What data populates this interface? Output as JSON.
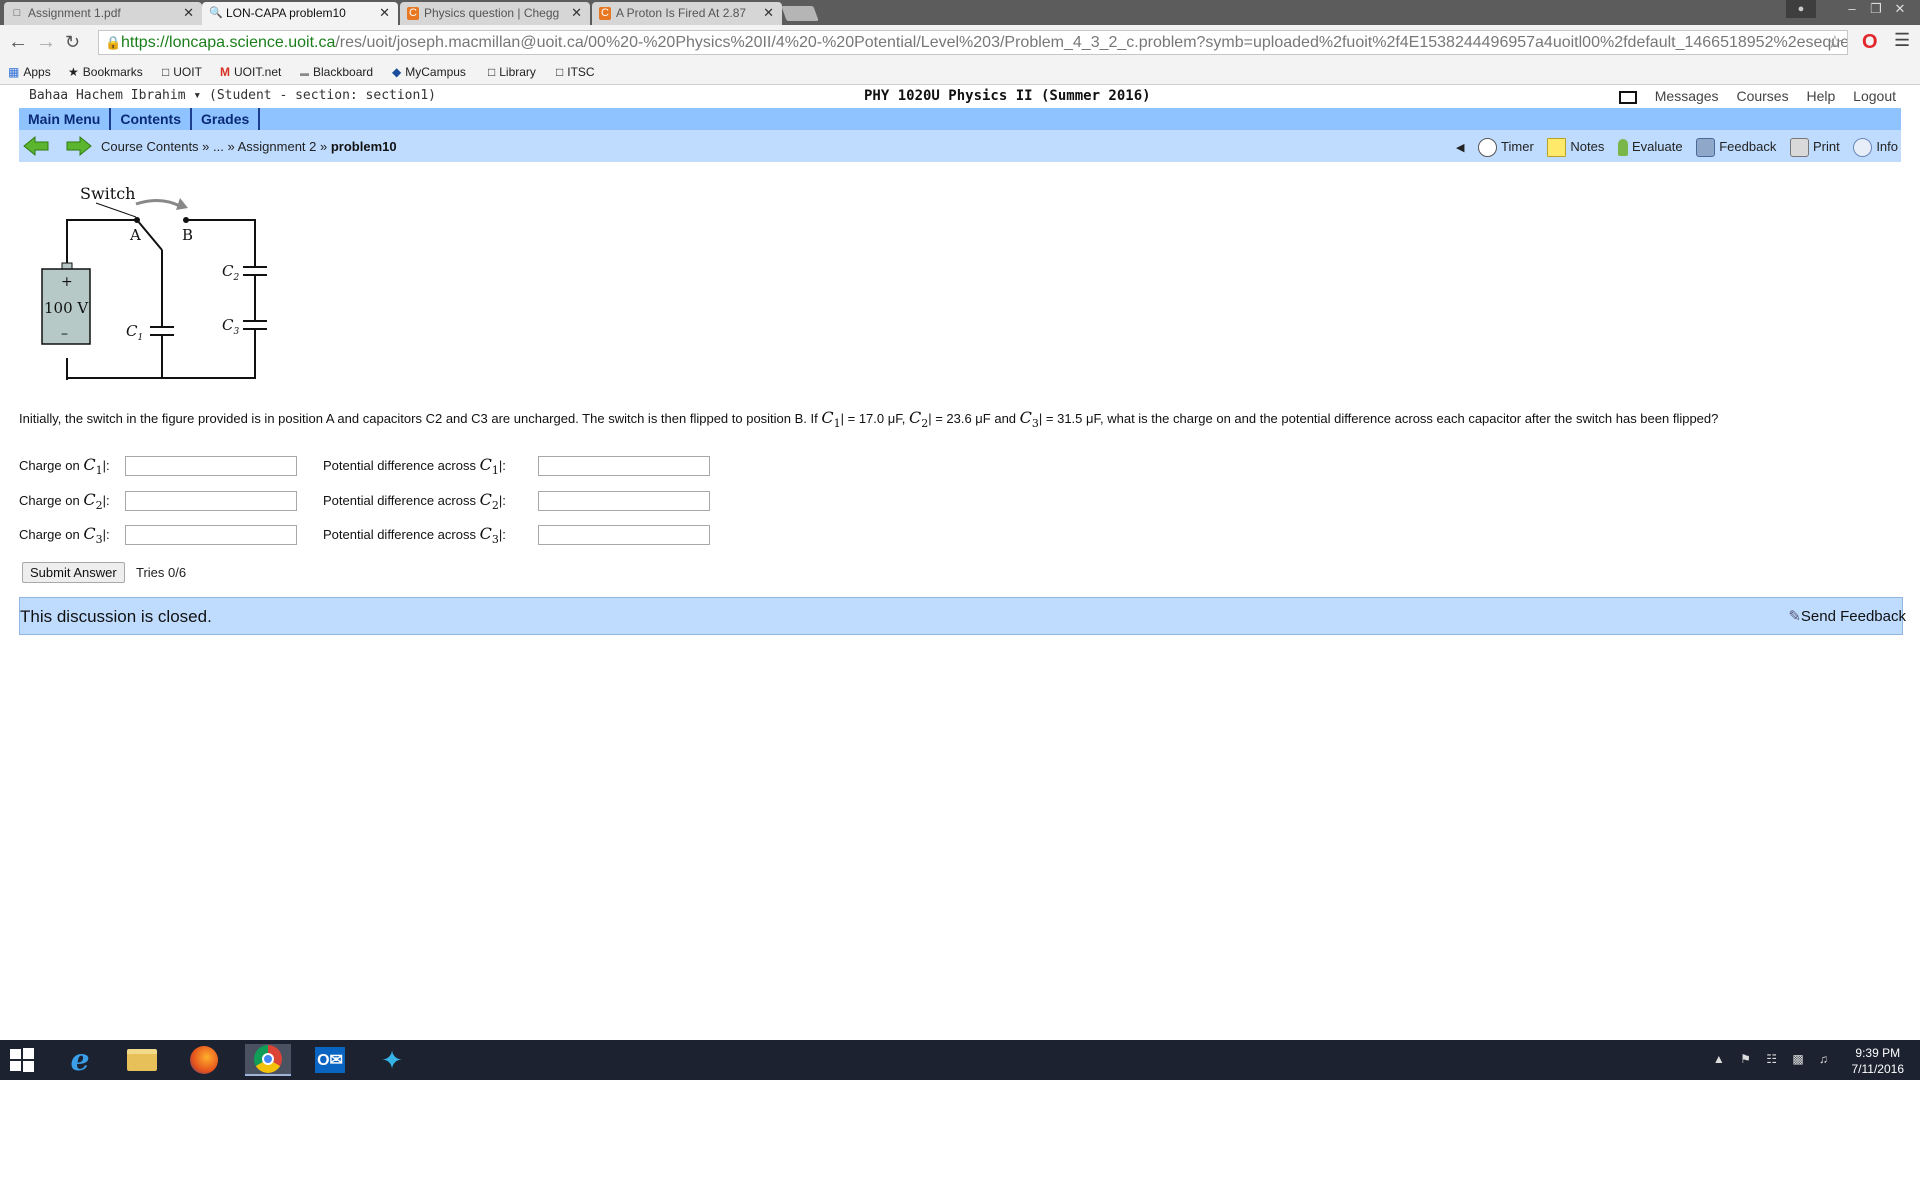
{
  "browser": {
    "tabs": [
      {
        "label": "Assignment 1.pdf",
        "icon": "document-icon",
        "active": false
      },
      {
        "label": "LON-CAPA problem10",
        "icon": "loncapa-icon",
        "active": true
      },
      {
        "label": "Physics question | Chegg",
        "icon": "chegg-icon",
        "active": false
      },
      {
        "label": "A Proton Is Fired At 2.87",
        "icon": "chegg-icon",
        "active": false
      }
    ],
    "url_host": "https://loncapa.science.uoit.ca",
    "url_path": "/res/uoit/joseph.macmillan@uoit.ca/00%20-%20Physics%20II/4%20-%20Potential/Level%203/Problem_4_3_2_c.problem?symb=uploaded%2fuoit%2f4E1538244496957a4uoitl00%2fdefault_1466518952%2esequen",
    "bookmarks": [
      "Apps",
      "Bookmarks",
      "UOIT",
      "UOIT.net",
      "Blackboard",
      "MyCampus",
      "Library",
      "ITSC"
    ]
  },
  "header": {
    "user": "Bahaa Hachem Ibrahim ▾ (Student  - section: section1)",
    "course": "PHY 1020U Physics II (Summer 2016)",
    "links": [
      "Messages",
      "Courses",
      "Help",
      "Logout"
    ]
  },
  "mainnav": [
    "Main Menu",
    "Contents",
    "Grades"
  ],
  "breadcrumb": {
    "root": "Course Contents »",
    "ellipsis": "... »",
    "assignment": "Assignment 2 »",
    "current": "problem10"
  },
  "tools": [
    "Timer",
    "Notes",
    "Evaluate",
    "Feedback",
    "Print",
    "Info"
  ],
  "figure": {
    "switch_label": "Switch",
    "pos_a": "A",
    "pos_b": "B",
    "battery": "100 V",
    "plus": "+",
    "minus": "–",
    "c1": "C",
    "c1_sub": "1",
    "c2": "C",
    "c2_sub": "2",
    "c3": "C",
    "c3_sub": "3"
  },
  "question": {
    "part1": "Initially, the switch in the figure provided is in position A and capacitors C2 and C3 are uncharged. The switch is then flipped to position B. If ",
    "c1": "C",
    "c1_sub": "1",
    "c1_val": "| = 17.0 μF, ",
    "c2": "C",
    "c2_sub": "2",
    "c2_val": "| = 23.6 μF and ",
    "c3": "C",
    "c3_sub": "3",
    "c3_val": "| = 31.5 μF, what is the charge on and the potential difference across each capacitor after the switch has been flipped?"
  },
  "answers": [
    {
      "charge_label": "Charge on ",
      "var": "C",
      "sub": "1",
      "suffix": "|:",
      "pd_label": "Potential difference across ",
      "charge_value": "",
      "pd_value": ""
    },
    {
      "charge_label": "Charge on ",
      "var": "C",
      "sub": "2",
      "suffix": "|:",
      "pd_label": "Potential difference across ",
      "charge_value": "",
      "pd_value": ""
    },
    {
      "charge_label": "Charge on ",
      "var": "C",
      "sub": "3",
      "suffix": "|:",
      "pd_label": "Potential difference across ",
      "charge_value": "",
      "pd_value": ""
    }
  ],
  "submit_label": "Submit Answer",
  "tries": "Tries 0/6",
  "discussion": {
    "message": "This discussion is closed.",
    "feedback": "Send Feedback"
  },
  "taskbar": {
    "time": "9:39 PM",
    "date": "7/11/2016"
  },
  "colors": {
    "nav_blue": "#8fc3ff",
    "crumb_blue": "#bfdcff",
    "taskbar": "#1c2230"
  }
}
